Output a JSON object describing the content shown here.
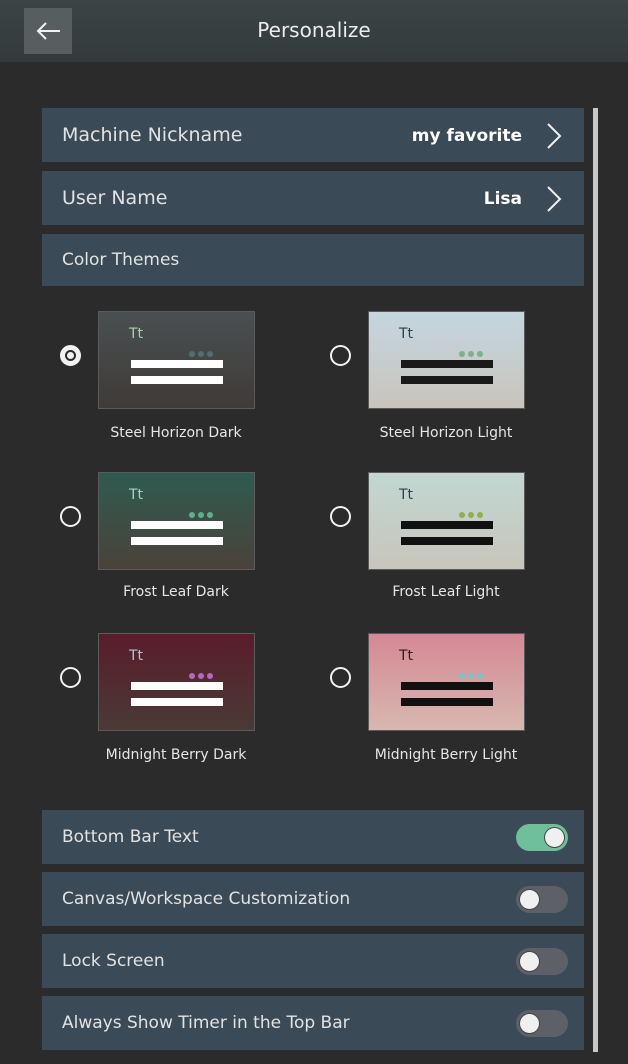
{
  "header": {
    "title": "Personalize",
    "back_icon": "arrow-left-icon"
  },
  "settings": {
    "machine_nickname": {
      "label": "Machine Nickname",
      "value": "my favorite"
    },
    "user_name": {
      "label": "User Name",
      "value": "Lisa"
    },
    "color_themes_label": "Color Themes"
  },
  "themes": [
    {
      "name": "Steel Horizon Dark",
      "selected": true,
      "bg_top": "#4a4f51",
      "bg_bottom": "#3f3b38",
      "tt_color": "#9fd6b2",
      "dot_color": "#4f6f72",
      "bar_color": "#ffffff"
    },
    {
      "name": "Steel Horizon Light",
      "selected": false,
      "bg_top": "#c4d6de",
      "bg_bottom": "#c9c4bd",
      "tt_color": "#2c3f52",
      "dot_color": "#7fb08a",
      "bar_color": "#1a1a1a"
    },
    {
      "name": "Frost Leaf Dark",
      "selected": false,
      "bg_top": "#2f5a50",
      "bg_bottom": "#4a423a",
      "tt_color": "#9fd8c8",
      "dot_color": "#5fb08a",
      "bar_color": "#ffffff"
    },
    {
      "name": "Frost Leaf Light",
      "selected": false,
      "bg_top": "#c2d7d2",
      "bg_bottom": "#c8c5bc",
      "tt_color": "#2c3f52",
      "dot_color": "#8fb04a",
      "bar_color": "#111111"
    },
    {
      "name": "Midnight Berry Dark",
      "selected": false,
      "bg_top": "#5a1c2c",
      "bg_bottom": "#4a3a36",
      "tt_color": "#a9c8e0",
      "dot_color": "#b06ac0",
      "bar_color": "#ffffff"
    },
    {
      "name": "Midnight Berry Light",
      "selected": false,
      "bg_top": "#d58894",
      "bg_bottom": "#d7b8b0",
      "tt_color": "#2a2020",
      "dot_color": "#7ac4c8",
      "bar_color": "#111111"
    }
  ],
  "toggles": [
    {
      "label": "Bottom Bar Text",
      "on": true
    },
    {
      "label": "Canvas/Workspace Customization",
      "on": false
    },
    {
      "label": "Lock Screen",
      "on": false
    },
    {
      "label": "Always Show Timer in the Top Bar",
      "on": false
    }
  ],
  "colors": {
    "background": "#2b2b2b",
    "row": "#3a4a56",
    "toggle_on": "#6fbf9b",
    "toggle_off": "#5d6066"
  }
}
